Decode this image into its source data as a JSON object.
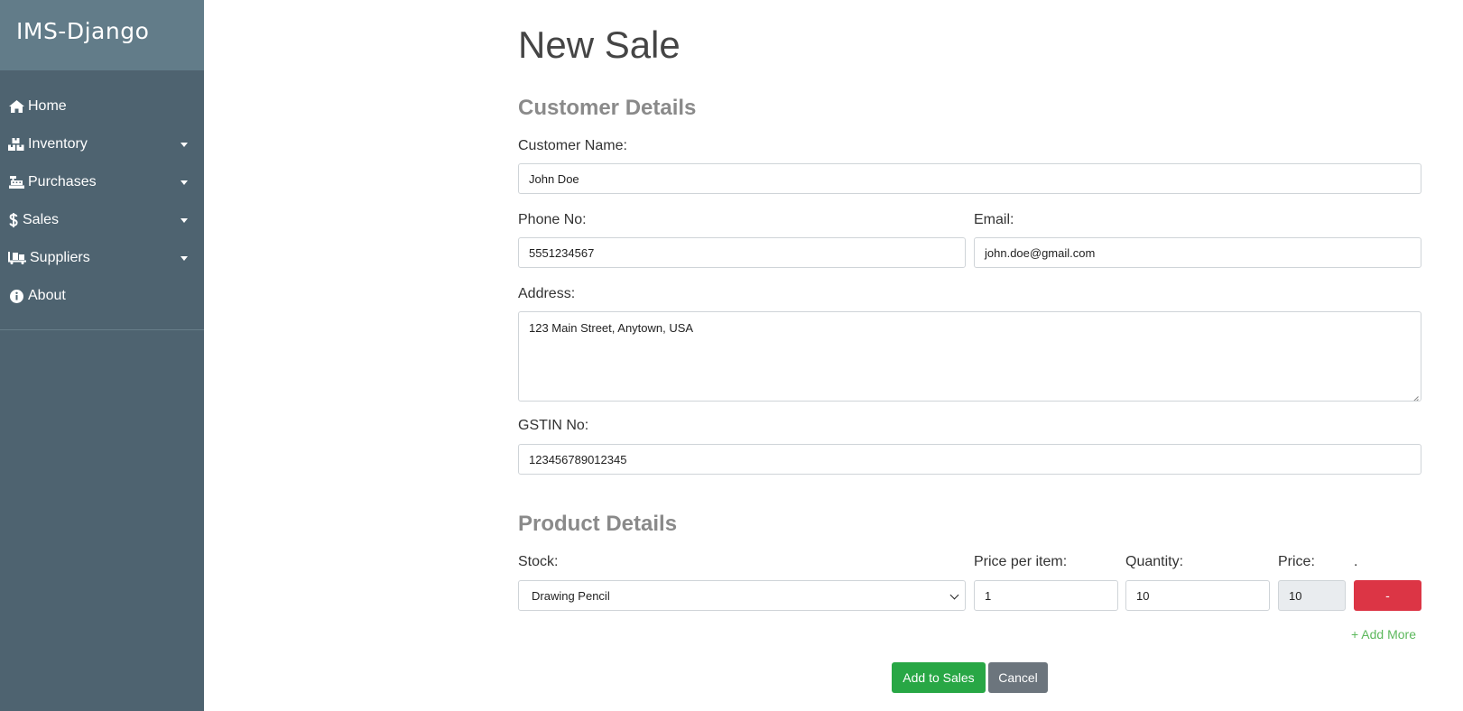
{
  "brand": {
    "title": "IMS-Django"
  },
  "sidebar": {
    "items": [
      {
        "label": "Home",
        "icon": "home-icon",
        "dropdown": false
      },
      {
        "label": "Inventory",
        "icon": "boxes-icon",
        "dropdown": true
      },
      {
        "label": "Purchases",
        "icon": "cash-register-icon",
        "dropdown": true
      },
      {
        "label": "Sales",
        "icon": "dollar-icon",
        "dropdown": true
      },
      {
        "label": "Suppliers",
        "icon": "dolly-icon",
        "dropdown": true
      },
      {
        "label": "About",
        "icon": "info-icon",
        "dropdown": false
      }
    ]
  },
  "page": {
    "title": "New Sale"
  },
  "customer": {
    "heading": "Customer Details",
    "name_label": "Customer Name:",
    "name_value": "John Doe",
    "phone_label": "Phone No:",
    "phone_value": "5551234567",
    "email_label": "Email:",
    "email_value": "john.doe@gmail.com",
    "address_label": "Address:",
    "address_value": "123 Main Street, Anytown, USA",
    "gstin_label": "GSTIN No:",
    "gstin_value": "123456789012345"
  },
  "product": {
    "heading": "Product Details",
    "stock_label": "Stock:",
    "price_per_item_label": "Price per item:",
    "quantity_label": "Quantity:",
    "price_label": "Price:",
    "dot_label": ".",
    "stock_value": "Drawing Pencil",
    "price_per_item_value": "1",
    "quantity_value": "10",
    "price_value": "10",
    "remove_label": "-",
    "add_more_label": "+ Add More"
  },
  "actions": {
    "submit_label": "Add to Sales",
    "cancel_label": "Cancel"
  },
  "colors": {
    "sidebar_bg": "#4e6370",
    "brand_bg": "#627c89",
    "danger": "#dc3545",
    "success": "#28a745",
    "secondary": "#6c757d",
    "add_more": "#5cb85c"
  }
}
